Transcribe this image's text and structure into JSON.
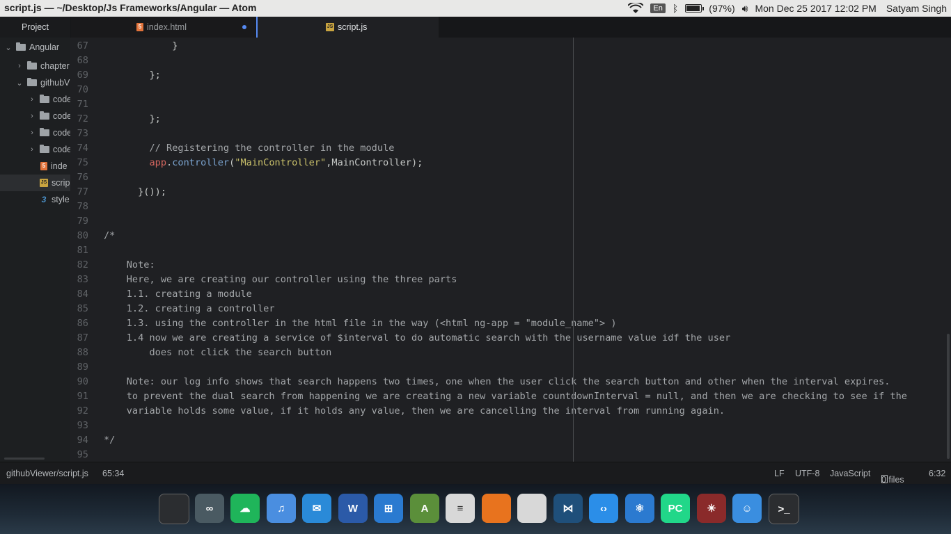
{
  "window": {
    "title": "script.js — ~/Desktop/Js Frameworks/Angular — Atom"
  },
  "system_tray": {
    "language": "En",
    "battery": "(97%)",
    "battery_level": 0.97,
    "datetime": "Mon Dec 25 2017 12:02 PM",
    "user": "Satyam Singh"
  },
  "project_panel": {
    "label": "Project",
    "tree": [
      {
        "label": "Angular",
        "type": "folder",
        "expanded": true
      },
      {
        "label": "chapter",
        "type": "folder",
        "expanded": false
      },
      {
        "label": "githubV",
        "type": "folder",
        "expanded": true
      },
      {
        "label": "code",
        "type": "folder",
        "expanded": false
      },
      {
        "label": "code",
        "type": "folder",
        "expanded": false
      },
      {
        "label": "code",
        "type": "folder",
        "expanded": false
      },
      {
        "label": "code",
        "type": "folder",
        "expanded": false
      },
      {
        "label": "inde",
        "type": "html"
      },
      {
        "label": "scrip",
        "type": "js",
        "selected": true
      },
      {
        "label": "style",
        "type": "css"
      }
    ]
  },
  "tabs": [
    {
      "label": "index.html",
      "icon": "html5-icon",
      "modified": true,
      "active": false
    },
    {
      "label": "script.js",
      "icon": "js-icon",
      "modified": false,
      "active": true
    }
  ],
  "editor": {
    "lines": [
      {
        "n": "67",
        "text": "            }"
      },
      {
        "n": "68",
        "text": ""
      },
      {
        "n": "69",
        "text": "        };"
      },
      {
        "n": "70",
        "text": ""
      },
      {
        "n": "71",
        "text": ""
      },
      {
        "n": "72",
        "text": "        };"
      },
      {
        "n": "73",
        "text": ""
      },
      {
        "n": "74",
        "text": "        // Registering the controller in the module",
        "kind": "comment"
      },
      {
        "n": "75",
        "kind": "call",
        "indent": "        ",
        "var": "app",
        "dot": ".",
        "fn": "controller",
        "open": "(",
        "str": "\"MainController\"",
        "rest": ",MainController);"
      },
      {
        "n": "76",
        "text": ""
      },
      {
        "n": "77",
        "text": "      }());"
      },
      {
        "n": "78",
        "text": ""
      },
      {
        "n": "79",
        "text": ""
      },
      {
        "n": "80",
        "text": "/*",
        "kind": "comment"
      },
      {
        "n": "81",
        "text": "",
        "kind": "comment"
      },
      {
        "n": "82",
        "text": "    Note:",
        "kind": "comment"
      },
      {
        "n": "83",
        "text": "    Here, we are creating our controller using the three parts",
        "kind": "comment"
      },
      {
        "n": "84",
        "text": "    1.1. creating a module",
        "kind": "comment"
      },
      {
        "n": "85",
        "text": "    1.2. creating a controller",
        "kind": "comment"
      },
      {
        "n": "86",
        "text": "    1.3. using the controller in the html file in the way (<html ng-app = \"module_name\"> )",
        "kind": "comment"
      },
      {
        "n": "87",
        "text": "    1.4 now we are creating a service of $interval to do automatic search with the username value idf the user",
        "kind": "comment"
      },
      {
        "n": "88",
        "text": "        does not click the search button",
        "kind": "comment"
      },
      {
        "n": "89",
        "text": "",
        "kind": "comment"
      },
      {
        "n": "90",
        "text": "    Note: our log info shows that search happens two times, one when the user click the search button and other when the interval expires.",
        "kind": "comment"
      },
      {
        "n": "91",
        "text": "    to prevent the dual search from happening we are creating a new variable countdownInterval = null, and then we are checking to see if the",
        "kind": "comment"
      },
      {
        "n": "92",
        "text": "    variable holds some value, if it holds any value, then we are cancelling the interval from running again.",
        "kind": "comment"
      },
      {
        "n": "93",
        "text": "",
        "kind": "comment"
      },
      {
        "n": "94",
        "text": "*/",
        "kind": "comment"
      },
      {
        "n": "95",
        "text": ""
      }
    ]
  },
  "status_bar": {
    "file_path": "githubViewer/script.js",
    "cursor": "65:34",
    "line_ending": "LF",
    "encoding": "UTF-8",
    "grammar": "JavaScript",
    "git_files": "0 files",
    "time": "6:32"
  },
  "dock": [
    {
      "name": "workspace-switcher-icon",
      "label": "",
      "color": "#2b2d30"
    },
    {
      "name": "arduino-icon",
      "label": "∞",
      "color": "#4a5a62"
    },
    {
      "name": "cloud-app-icon",
      "label": "☁",
      "color": "#1fb55a"
    },
    {
      "name": "music-cloud-icon",
      "label": "♫",
      "color": "#4a8ee0"
    },
    {
      "name": "mail-bird-icon",
      "label": "✉",
      "color": "#2a8ad8"
    },
    {
      "name": "word-icon",
      "label": "W",
      "color": "#2b5aa8"
    },
    {
      "name": "app-grid-icon",
      "label": "⊞",
      "color": "#2a7ad0"
    },
    {
      "name": "android-studio-icon",
      "label": "A",
      "color": "#5b8f3a"
    },
    {
      "name": "text-editor-icon",
      "label": "≡",
      "color": "#d8d8d8"
    },
    {
      "name": "firefox-icon",
      "label": "",
      "color": "#e8731e"
    },
    {
      "name": "chrome-icon",
      "label": "",
      "color": "#d8d8d8"
    },
    {
      "name": "vscode-icon",
      "label": "⋈",
      "color": "#1f4f7a"
    },
    {
      "name": "code-bracket-icon",
      "label": "‹›",
      "color": "#2b8ee8"
    },
    {
      "name": "atom-icon",
      "label": "⚛",
      "color": "#2b7ad0"
    },
    {
      "name": "pycharm-icon",
      "label": "PC",
      "color": "#21d789"
    },
    {
      "name": "spider-web-icon",
      "label": "✳",
      "color": "#8a2a2a"
    },
    {
      "name": "finder-icon",
      "label": "☺",
      "color": "#3a8ee0"
    },
    {
      "name": "terminal-icon",
      "label": ">_",
      "color": "#2b2d30"
    }
  ]
}
